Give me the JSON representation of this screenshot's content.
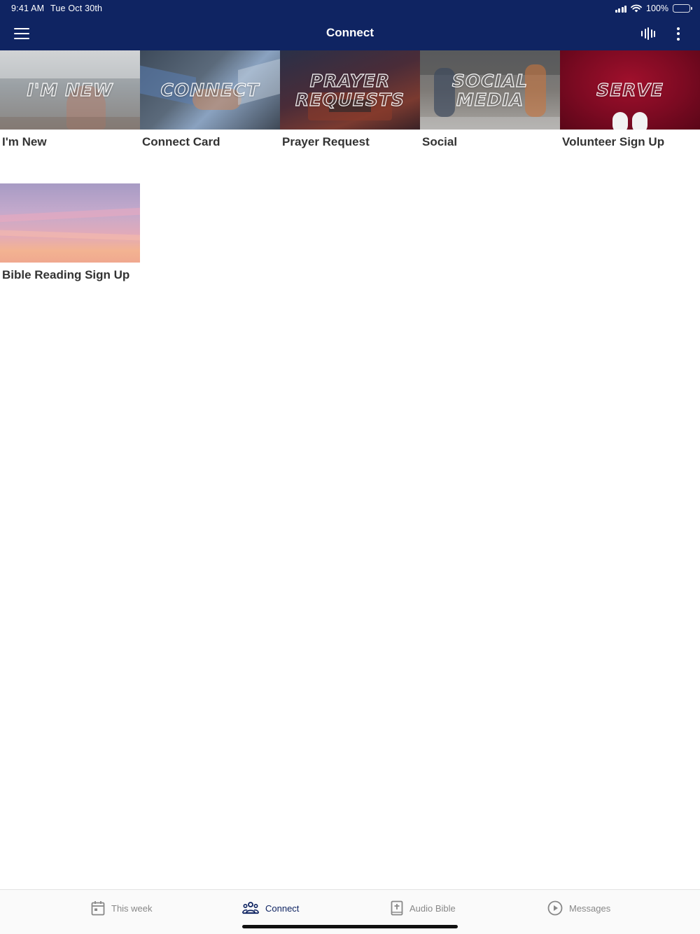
{
  "status_bar": {
    "time": "9:41 AM",
    "date": "Tue Oct 30th",
    "battery_percent": "100%",
    "icons": [
      "signal-icon",
      "wifi-icon",
      "battery-icon"
    ]
  },
  "nav": {
    "title": "Connect",
    "left_icon": "hamburger-menu-icon",
    "right_icons": [
      "audio-bars-icon",
      "more-vertical-icon"
    ]
  },
  "tiles": [
    {
      "overlay": "I'M NEW",
      "label": "I'm New"
    },
    {
      "overlay": "CONNECT",
      "label": "Connect Card"
    },
    {
      "overlay": "PRAYER\nREQUESTS",
      "label": "Prayer Request"
    },
    {
      "overlay": "SOCIAL\nMEDIA",
      "label": "Social"
    },
    {
      "overlay": "SERVE",
      "label": "Volunteer Sign Up"
    },
    {
      "overlay": "",
      "label": "Bible Reading Sign Up"
    }
  ],
  "tabbar": {
    "items": [
      {
        "label": "This week",
        "icon": "calendar-icon",
        "active": false
      },
      {
        "label": "Connect",
        "icon": "people-icon",
        "active": true
      },
      {
        "label": "Audio Bible",
        "icon": "bible-icon",
        "active": false
      },
      {
        "label": "Messages",
        "icon": "play-circle-icon",
        "active": false
      }
    ]
  },
  "colors": {
    "header_bg": "#0f2462",
    "active_tab": "#0f2462",
    "inactive_tab": "#888888",
    "caption_text": "#333333"
  }
}
